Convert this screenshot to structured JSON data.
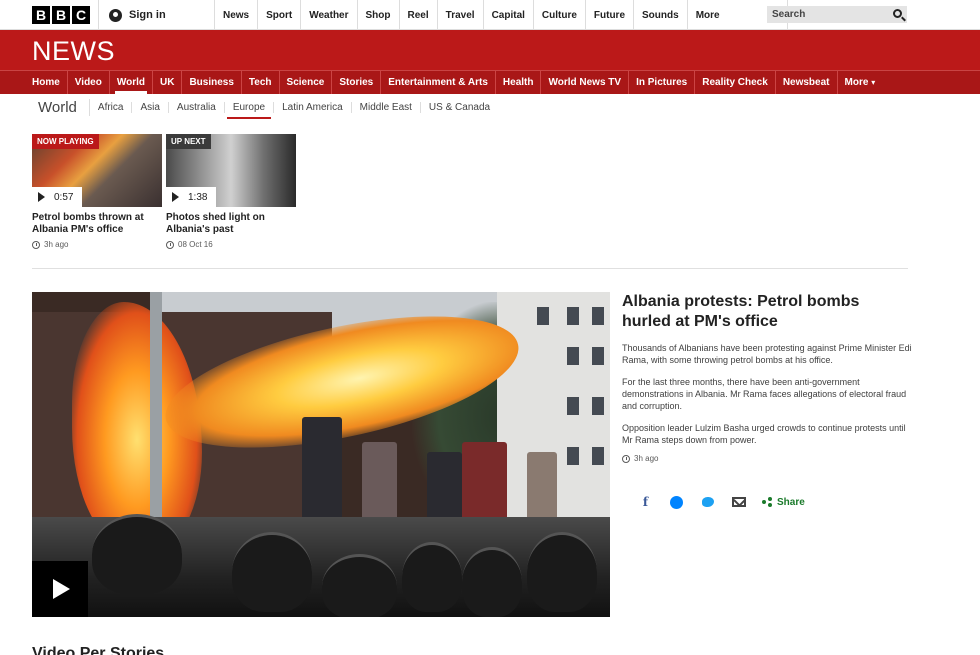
{
  "topbar": {
    "logo_letters": [
      "B",
      "B",
      "C"
    ],
    "signin_label": "Sign in",
    "nav": [
      "News",
      "Sport",
      "Weather",
      "Shop",
      "Reel",
      "Travel",
      "Capital",
      "Culture",
      "Future",
      "Sounds"
    ],
    "more_label": "More",
    "search_placeholder": "Search"
  },
  "newsband": {
    "wordmark": "NEWS"
  },
  "mainnav": {
    "items": [
      "Home",
      "Video",
      "World",
      "UK",
      "Business",
      "Tech",
      "Science",
      "Stories",
      "Entertainment & Arts",
      "Health",
      "World News TV",
      "In Pictures",
      "Reality Check",
      "Newsbeat"
    ],
    "more_label": "More",
    "active": "World"
  },
  "worldnav": {
    "title": "World",
    "items": [
      "Africa",
      "Asia",
      "Australia",
      "Europe",
      "Latin America",
      "Middle East",
      "US & Canada"
    ],
    "active": "Europe"
  },
  "videos": [
    {
      "badge": "NOW PLAYING",
      "duration": "0:57",
      "title": "Petrol bombs thrown at Albania PM's office",
      "time": "3h ago"
    },
    {
      "badge": "UP NEXT",
      "duration": "1:38",
      "title": "Photos shed light on Albania's past",
      "time": "08 Oct 16"
    }
  ],
  "story": {
    "headline": "Albania protests: Petrol bombs hurled at PM's office",
    "paragraphs": [
      "Thousands of Albanians have been protesting against Prime Minister Edi Rama, with some throwing petrol bombs at his office.",
      "For the last three months, there have been anti-government demonstrations in Albania. Mr Rama faces allegations of electoral fraud and corruption.",
      "Opposition leader Lulzim Basha urged crowds to continue protests until Mr Rama steps down from power."
    ],
    "time": "3h ago",
    "share_label": "Share"
  },
  "section_heading": "Video Per Stories",
  "colors": {
    "brand_red": "#bb1919",
    "nav_red": "#a91717",
    "share_green": "#1a7a2a"
  }
}
